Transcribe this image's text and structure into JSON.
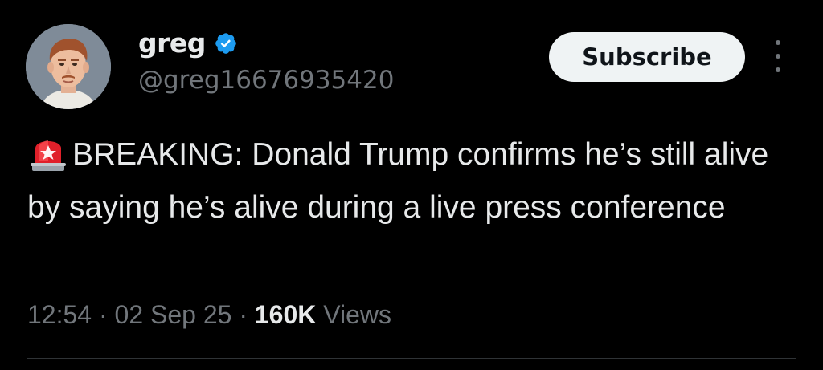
{
  "author": {
    "display_name": "greg",
    "handle": "@greg16676935420",
    "verified": true,
    "avatar_icon": "profile-photo"
  },
  "actions": {
    "subscribe_label": "Subscribe",
    "more_icon": "more-options-icon"
  },
  "tweet": {
    "emoji_icon": "siren-icon",
    "text": "BREAKING: Donald Trump confirms he’s still alive by saying he’s alive during a live press conference"
  },
  "meta": {
    "time": "12:54",
    "date": "02 Sep 25",
    "separator": "·",
    "views_count": "160K",
    "views_label": "Views"
  },
  "colors": {
    "background": "#000000",
    "text_primary": "#e7e9ea",
    "text_secondary": "#71767b",
    "verified_blue": "#1d9bf0",
    "button_bg": "#eff3f4"
  }
}
